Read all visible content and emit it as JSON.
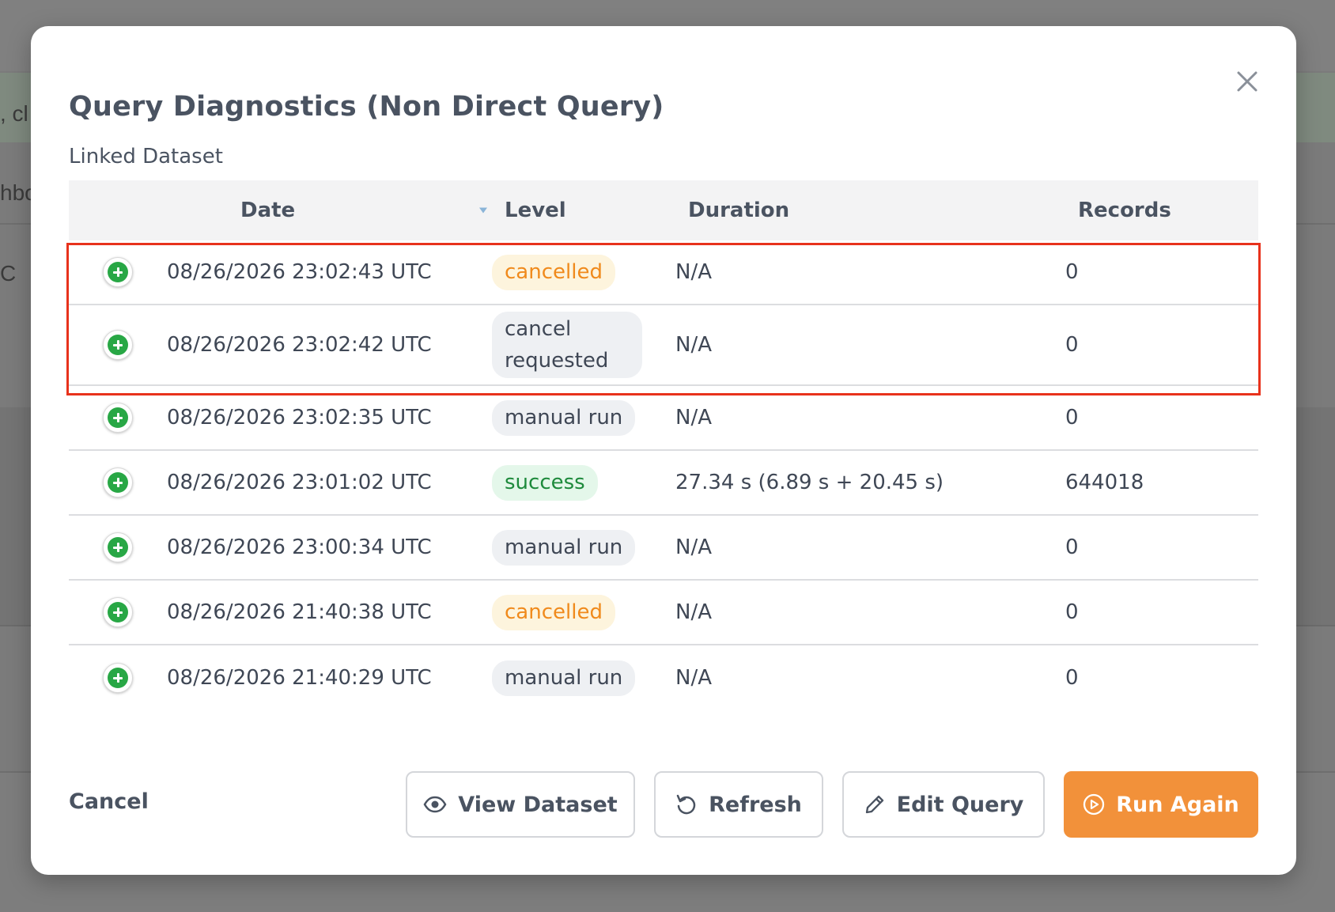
{
  "background": {
    "fragments": [
      ", cl",
      "hbo",
      "C"
    ]
  },
  "modal": {
    "title": "Query Diagnostics (Non Direct Query)",
    "subtitle": "Linked Dataset",
    "close_icon": "close-icon"
  },
  "table": {
    "columns": [
      "Date",
      "Level",
      "Duration",
      "Records"
    ],
    "sort": {
      "column": "Date",
      "direction": "descending"
    },
    "rows": [
      {
        "date": "08/26/2026 23:02:43 UTC",
        "level": "cancelled",
        "duration": "N/A",
        "records": "0"
      },
      {
        "date": "08/26/2026 23:02:42 UTC",
        "level": "cancel requested",
        "duration": "N/A",
        "records": "0"
      },
      {
        "date": "08/26/2026 23:02:35 UTC",
        "level": "manual run",
        "duration": "N/A",
        "records": "0"
      },
      {
        "date": "08/26/2026 23:01:02 UTC",
        "level": "success",
        "duration": "27.34 s (6.89 s + 20.45 s)",
        "records": "644018"
      },
      {
        "date": "08/26/2026 23:00:34 UTC",
        "level": "manual run",
        "duration": "N/A",
        "records": "0"
      },
      {
        "date": "08/26/2026 21:40:38 UTC",
        "level": "cancelled",
        "duration": "N/A",
        "records": "0"
      },
      {
        "date": "08/26/2026 21:40:29 UTC",
        "level": "manual run",
        "duration": "N/A",
        "records": "0"
      }
    ],
    "highlighted_rows": [
      0,
      1
    ],
    "highlight_color": "#e8321c"
  },
  "footer": {
    "cancel_label": "Cancel",
    "view_dataset_label": "View Dataset",
    "refresh_label": "Refresh",
    "edit_query_label": "Edit Query",
    "run_again_label": "Run Again"
  },
  "colors": {
    "primary": "#f2913a",
    "success": "#28a745",
    "cancelled_text": "#f08a1c",
    "success_text": "#1e8a3c"
  }
}
